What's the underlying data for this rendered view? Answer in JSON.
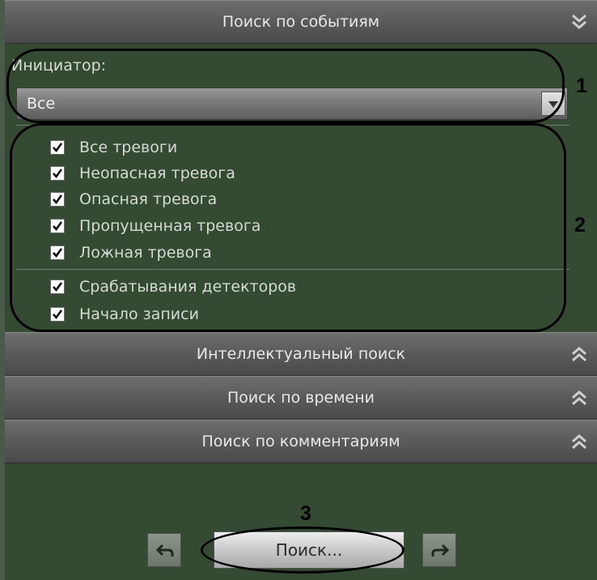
{
  "sections": {
    "event_search": {
      "title": "Поиск по событиям",
      "icon": "double-chevron-down-icon"
    },
    "smart_search": {
      "title": "Интеллектуальный поиск",
      "icon": "double-chevron-up-icon"
    },
    "time_search": {
      "title": "Поиск по времени",
      "icon": "double-chevron-up-icon"
    },
    "comment_search": {
      "title": "Поиск по комментариям",
      "icon": "double-chevron-up-icon"
    }
  },
  "initiator": {
    "label": "Инициатор:",
    "selected": "Все"
  },
  "alarm_filters": [
    {
      "label": "Все тревоги",
      "checked": true
    },
    {
      "label": "Неопасная тревога",
      "checked": true
    },
    {
      "label": "Опасная тревога",
      "checked": true
    },
    {
      "label": "Пропущенная тревога",
      "checked": true
    },
    {
      "label": "Ложная тревога",
      "checked": true
    }
  ],
  "other_filters": [
    {
      "label": "Срабатывания детекторов",
      "checked": true
    },
    {
      "label": "Начало записи",
      "checked": true
    }
  ],
  "buttons": {
    "search": "Поиск...",
    "back_icon": "back-arrow-icon",
    "forward_icon": "forward-arrow-icon"
  },
  "callouts": {
    "c1": "1",
    "c2": "2",
    "c3": "3"
  }
}
